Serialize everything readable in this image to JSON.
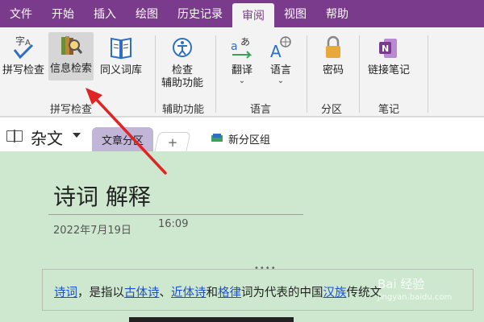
{
  "menubar": {
    "items": [
      {
        "label": "文件"
      },
      {
        "label": "开始"
      },
      {
        "label": "插入"
      },
      {
        "label": "绘图"
      },
      {
        "label": "历史记录"
      },
      {
        "label": "审阅",
        "active": true
      },
      {
        "label": "视图"
      },
      {
        "label": "帮助"
      }
    ]
  },
  "ribbon": {
    "spelling": "拼写检查",
    "research": "信息检索",
    "thesaurus": "同义词库",
    "group_spelling": "拼写检查",
    "accessibility_line1": "检查",
    "accessibility_line2": "辅助功能",
    "group_accessibility": "辅助功能",
    "translate": "翻译",
    "language": "语言",
    "group_language": "语言",
    "password": "密码",
    "group_section": "分区",
    "linked_notes": "链接笔记",
    "group_notes": "笔记",
    "colors": {
      "spelling": "#2e6fc4",
      "accent": "#7a3b8c",
      "onenote": "#7a3b8c",
      "lock": "#e8a93a"
    }
  },
  "sectionbar": {
    "notebook_name": "杂文",
    "active_tab": "文章分区",
    "add_tab": "+",
    "new_group": "新分区组"
  },
  "page": {
    "title": "诗词 解释",
    "date": "2022年7月19日",
    "time": "16:09",
    "content": {
      "link1": "诗词",
      "text1": "，是指以",
      "link2": "古体诗",
      "text2": "、",
      "link3": "近体诗",
      "text3": "和",
      "link4": "格律",
      "text4": "词为代表的中国",
      "link5": "汉族",
      "text5": "传统文"
    }
  },
  "watermark": {
    "main": "Bai 经验",
    "sub": "jingyan.baidu.com"
  },
  "colors": {
    "menubar": "#7a3b8c",
    "page_bg": "#cde8cf",
    "arrow": "#e02424",
    "link": "#1a4fd6"
  }
}
